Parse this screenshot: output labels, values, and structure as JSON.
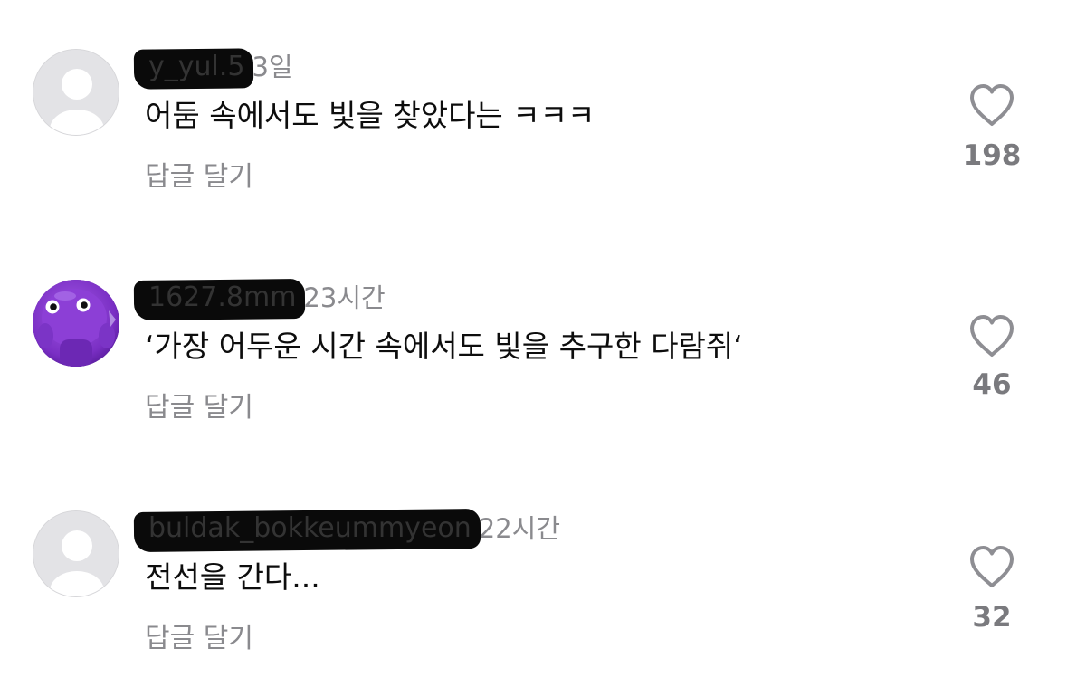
{
  "comments": [
    {
      "username": "y_yul.5",
      "time": "3일",
      "text": "어둠 속에서도 빛을 찾았다는 ㅋㅋㅋ",
      "reply_label": "답글 달기",
      "likes": "198",
      "avatar": "default-avatar"
    },
    {
      "username": "1627.8mm",
      "time": "23시간",
      "text": "‘가장 어두운 시간 속에서도 빛을 추구한 다람쥐‘",
      "reply_label": "답글 달기",
      "likes": "46",
      "avatar": "purple-character-avatar"
    },
    {
      "username": "buldak_bokkeummyeon",
      "time": "22시간",
      "text": "전선을 간다...",
      "reply_label": "답글 달기",
      "likes": "32",
      "avatar": "default-avatar"
    }
  ],
  "colors": {
    "meta_gray": "#8a8a8e",
    "avatar_default": "#e3e3e6",
    "avatar_purple": "#8a3fd1"
  },
  "icons": {
    "like": "heart-outline-icon",
    "avatar_placeholder": "person-silhouette-icon"
  }
}
